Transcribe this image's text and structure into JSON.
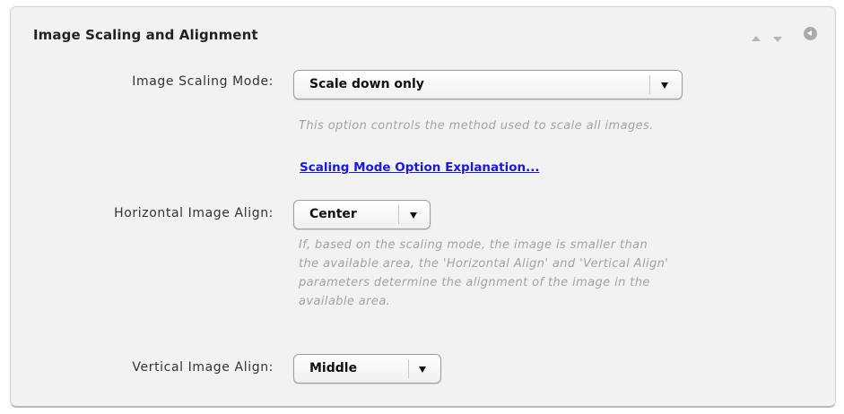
{
  "panel": {
    "title": "Image Scaling and Alignment",
    "icons": {
      "move_up": "triangle-up-icon",
      "move_down": "triangle-down-icon",
      "collapse": "collapse-circle-icon"
    }
  },
  "fields": {
    "scaling_mode": {
      "label": "Image Scaling Mode:",
      "value": "Scale down only",
      "help": "This option controls the method used to scale all images."
    },
    "scaling_link": {
      "text": "Scaling Mode Option Explanation..."
    },
    "horizontal_align": {
      "label": "Horizontal Image Align:",
      "value": "Center",
      "help_lines": [
        "If, based on the scaling mode, the image is smaller than",
        "the available area, the 'Horizontal Align' and 'Vertical Align'",
        "parameters determine the alignment of the image in the",
        "available area."
      ]
    },
    "vertical_align": {
      "label": "Vertical Image Align:",
      "value": "Middle"
    }
  },
  "colors": {
    "panel_background": "#f2f2f2",
    "link": "#1a1ad6",
    "help_text": "#a3a3a3"
  }
}
